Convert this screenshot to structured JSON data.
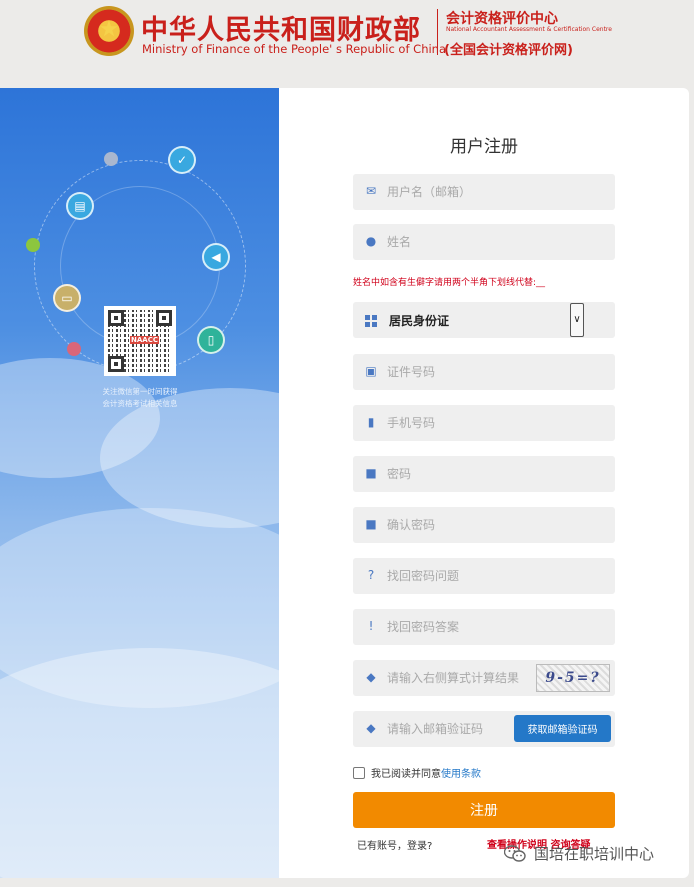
{
  "header": {
    "title_cn": "中华人民共和国财政部",
    "title_en": "Ministry of Finance of the People' s Republic of China",
    "center_cn": "会计资格评价中心",
    "center_en": "National Accountant Assessment & Certification Centre",
    "center_sub": "(全国会计资格评价网)"
  },
  "left_panel": {
    "qr_label": "NAACC",
    "caption_line1": "关注微信第一时间获得",
    "caption_line2": "会计资格考试相关信息"
  },
  "form": {
    "title": "用户注册",
    "fields": {
      "username": {
        "placeholder": "用户名（邮箱）",
        "icon": "envelope-icon"
      },
      "name": {
        "placeholder": "姓名",
        "icon": "person-icon"
      },
      "id_number": {
        "placeholder": "证件号码",
        "icon": "id-card-icon"
      },
      "phone": {
        "placeholder": "手机号码",
        "icon": "phone-icon"
      },
      "password": {
        "placeholder": "密码",
        "icon": "lock-icon"
      },
      "confirm_password": {
        "placeholder": "确认密码",
        "icon": "lock-icon"
      },
      "security_question": {
        "placeholder": "找回密码问题",
        "icon": "question-icon"
      },
      "security_answer": {
        "placeholder": "找回密码答案",
        "icon": "exclamation-icon"
      },
      "captcha": {
        "placeholder": "请输入右侧算式计算结果",
        "icon": "shield-icon"
      },
      "email_code": {
        "placeholder": "请输入邮箱验证码",
        "icon": "shield-icon"
      }
    },
    "name_hint": "姓名中如含有生僻字请用两个半角下划线代替:__",
    "id_type_selected": "居民身份证",
    "captcha_image_text": "9-5=?",
    "email_code_button": "获取邮箱验证码",
    "agree_text": "我已阅读并同意",
    "agree_link": "使用条款",
    "submit_label": "注册",
    "has_account": "已有账号，登录?",
    "help_links": "查看操作说明  咨询答疑"
  },
  "watermark": {
    "text": "国培在职培训中心"
  },
  "colors": {
    "brand_red": "#c9201b",
    "submit_orange": "#f28a00",
    "link_blue": "#2478c8",
    "panel_blue": "#2d74d8"
  }
}
